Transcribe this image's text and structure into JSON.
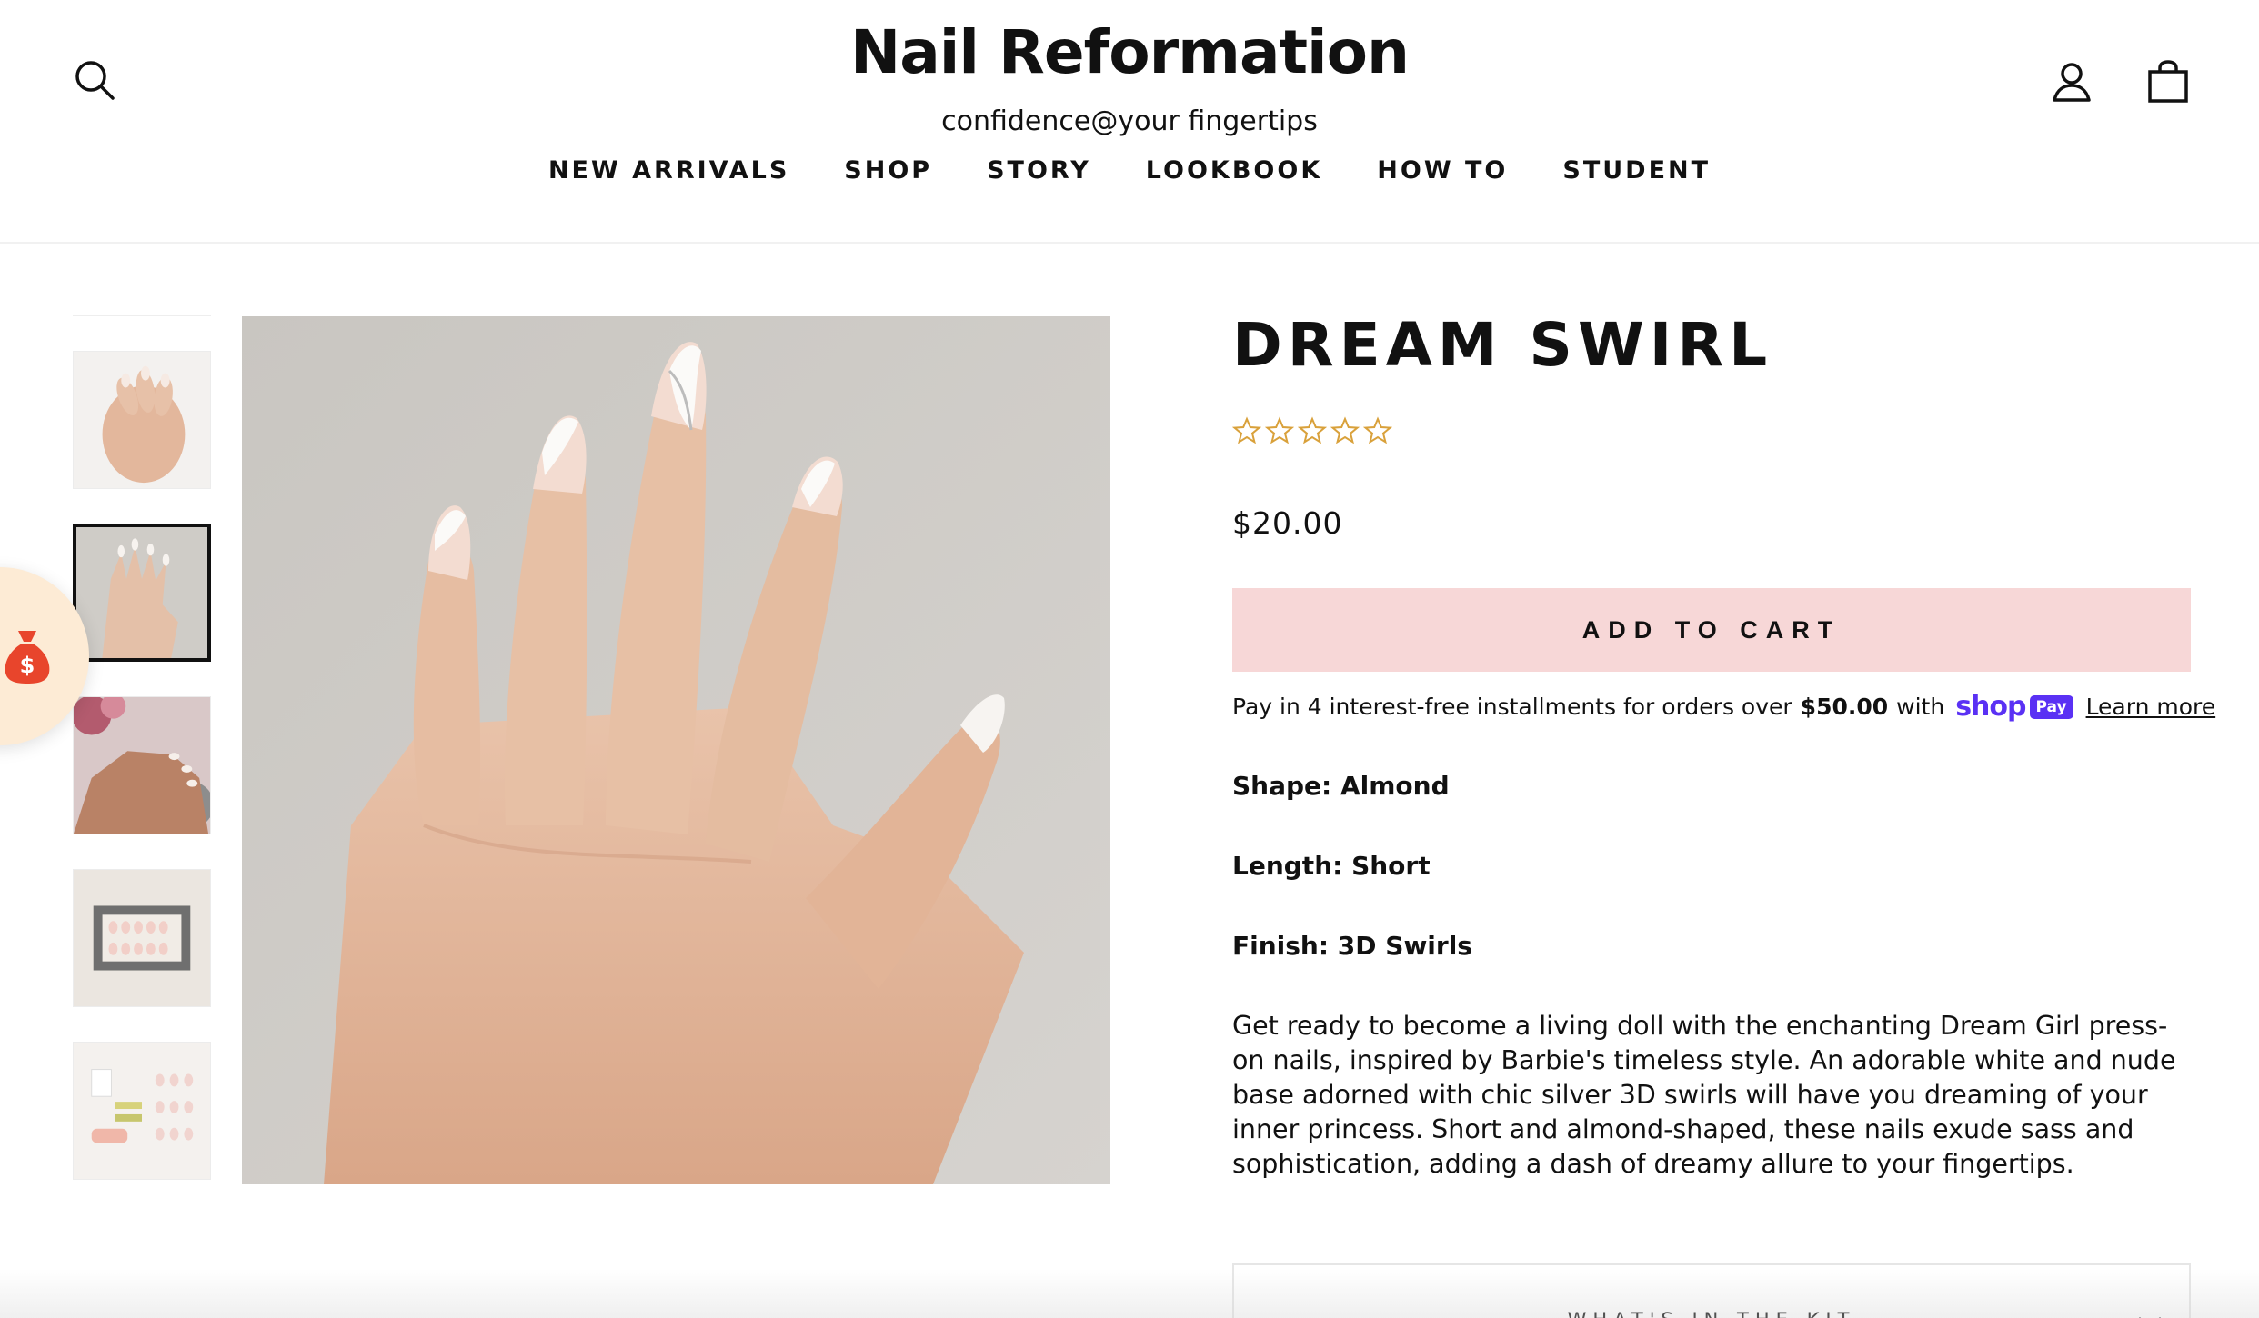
{
  "header": {
    "brand_name": "Nail Reformation",
    "tagline": "confidence@your fingertips",
    "icons": {
      "search": "search-icon",
      "account": "user-icon",
      "cart": "shopping-bag-icon"
    },
    "nav": [
      {
        "label": "NEW ARRIVALS"
      },
      {
        "label": "SHOP"
      },
      {
        "label": "STORY"
      },
      {
        "label": "LOOKBOOK"
      },
      {
        "label": "HOW TO"
      },
      {
        "label": "STUDENT"
      }
    ]
  },
  "reward_icon": "money-bag-icon",
  "gallery": {
    "thumbnails_count": 5,
    "active_index": 1
  },
  "product": {
    "title": "DREAM SWIRL",
    "rating": 0,
    "rating_max": 5,
    "price": "$20.00",
    "add_to_cart": "ADD TO CART",
    "installments": {
      "prefix": "Pay in 4 interest-free installments for orders over",
      "amount": "$50.00",
      "suffix": "with",
      "shop_word": "shop",
      "pay_word": "Pay",
      "learn_more": "Learn more"
    },
    "shape": "Shape: Almond",
    "length": "Length: Short",
    "finish": "Finish: 3D Swirls",
    "description": "Get ready to become a living doll with the enchanting Dream Girl press-on nails, inspired by Barbie's timeless style. An adorable white and nude base adorned with chic silver 3D swirls will have you dreaming of your inner princess. Short and almond-shaped, these nails exude sass and sophistication, adding a dash of dreamy allure to your fingertips.",
    "kit_label": "WHAT'S IN THE KIT"
  },
  "colors": {
    "accent_pink": "#f7d7d7",
    "shop_pay_purple": "#5a31f4",
    "star_gold": "#d9a13b",
    "reward_bg": "#fdebd5",
    "reward_icon": "#e8452c"
  }
}
